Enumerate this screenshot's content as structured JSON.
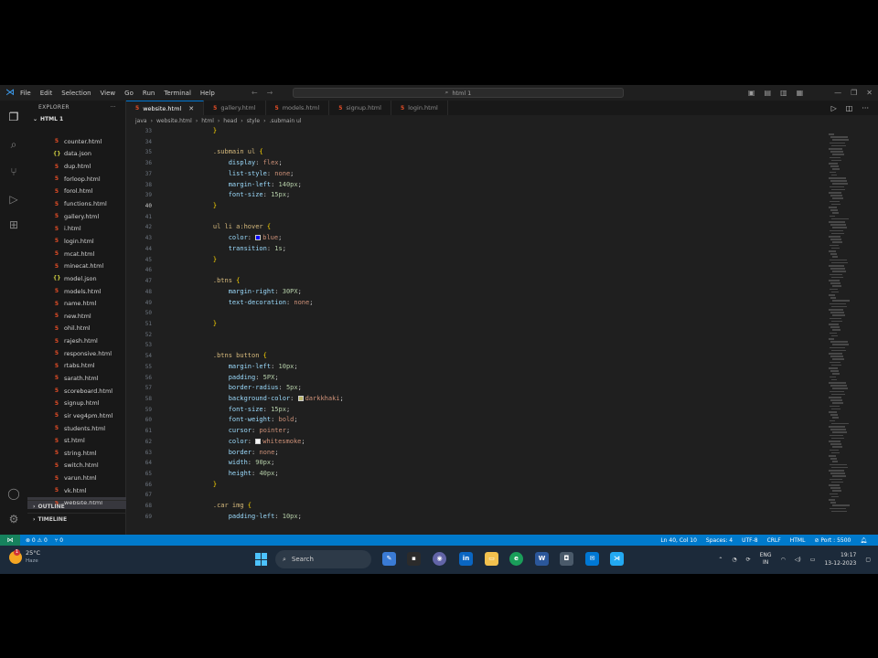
{
  "titlebar": {
    "menu": [
      "File",
      "Edit",
      "Selection",
      "View",
      "Go",
      "Run",
      "Terminal",
      "Help"
    ],
    "search_text": "html 1"
  },
  "sidebar": {
    "title": "EXPLORER",
    "more": "···",
    "folder": "HTML 1",
    "files": [
      {
        "name": "counter.html",
        "type": "html"
      },
      {
        "name": "data.json",
        "type": "json"
      },
      {
        "name": "dup.html",
        "type": "html"
      },
      {
        "name": "forloop.html",
        "type": "html"
      },
      {
        "name": "forol.html",
        "type": "html"
      },
      {
        "name": "functions.html",
        "type": "html"
      },
      {
        "name": "gallery.html",
        "type": "html"
      },
      {
        "name": "i.html",
        "type": "html"
      },
      {
        "name": "login.html",
        "type": "html"
      },
      {
        "name": "mcat.html",
        "type": "html"
      },
      {
        "name": "minecat.html",
        "type": "html"
      },
      {
        "name": "model.json",
        "type": "json"
      },
      {
        "name": "models.html",
        "type": "html"
      },
      {
        "name": "name.html",
        "type": "html"
      },
      {
        "name": "new.html",
        "type": "html"
      },
      {
        "name": "ohil.html",
        "type": "html"
      },
      {
        "name": "rajesh.html",
        "type": "html"
      },
      {
        "name": "responsive.html",
        "type": "html"
      },
      {
        "name": "rtabs.html",
        "type": "html"
      },
      {
        "name": "sarath.html",
        "type": "html"
      },
      {
        "name": "scoreboard.html",
        "type": "html"
      },
      {
        "name": "signup.html",
        "type": "html"
      },
      {
        "name": "sir veg4pm.html",
        "type": "html"
      },
      {
        "name": "students.html",
        "type": "html"
      },
      {
        "name": "st.html",
        "type": "html"
      },
      {
        "name": "string.html",
        "type": "html"
      },
      {
        "name": "switch.html",
        "type": "html"
      },
      {
        "name": "varun.html",
        "type": "html"
      },
      {
        "name": "vk.html",
        "type": "html"
      },
      {
        "name": "website.html",
        "type": "html",
        "active": true
      }
    ],
    "outline": "OUTLINE",
    "timeline": "TIMELINE"
  },
  "tabs": [
    {
      "label": "website.html",
      "active": true
    },
    {
      "label": "gallery.html",
      "active": false
    },
    {
      "label": "models.html",
      "active": false
    },
    {
      "label": "signup.html",
      "active": false
    },
    {
      "label": "login.html",
      "active": false
    }
  ],
  "breadcrumb": [
    "java",
    "website.html",
    "html",
    "head",
    "style",
    ".submain ul"
  ],
  "editor": {
    "current_line": "40",
    "lines": [
      {
        "n": "33",
        "t": [
          [
            "brace",
            "    }"
          ]
        ]
      },
      {
        "n": "34",
        "t": []
      },
      {
        "n": "35",
        "t": [
          [
            "sel",
            "    .submain ul "
          ],
          [
            "brace",
            "{"
          ]
        ]
      },
      {
        "n": "36",
        "t": [
          [
            "prop",
            "        display"
          ],
          [
            "",
            ": "
          ],
          [
            "val",
            "flex"
          ],
          [
            "",
            ";"
          ]
        ]
      },
      {
        "n": "37",
        "t": [
          [
            "prop",
            "        list-style"
          ],
          [
            "",
            ": "
          ],
          [
            "val",
            "none"
          ],
          [
            "",
            ";"
          ]
        ]
      },
      {
        "n": "38",
        "t": [
          [
            "prop",
            "        margin-left"
          ],
          [
            "",
            ": "
          ],
          [
            "num",
            "140px"
          ],
          [
            "",
            ";"
          ]
        ]
      },
      {
        "n": "39",
        "t": [
          [
            "prop",
            "        font-size"
          ],
          [
            "",
            ": "
          ],
          [
            "num",
            "15px"
          ],
          [
            "",
            ";"
          ]
        ]
      },
      {
        "n": "40",
        "t": [
          [
            "brace",
            "    }"
          ]
        ]
      },
      {
        "n": "41",
        "t": []
      },
      {
        "n": "42",
        "t": [
          [
            "sel",
            "    ul li a:hover "
          ],
          [
            "brace",
            "{"
          ]
        ]
      },
      {
        "n": "43",
        "t": [
          [
            "prop",
            "        color"
          ],
          [
            "",
            ": "
          ],
          [
            "swatch",
            "#0000ff"
          ],
          [
            "val",
            "blue"
          ],
          [
            "",
            ";"
          ]
        ]
      },
      {
        "n": "44",
        "t": [
          [
            "prop",
            "        transition"
          ],
          [
            "",
            ": "
          ],
          [
            "num",
            "1s"
          ],
          [
            "",
            ";"
          ]
        ]
      },
      {
        "n": "45",
        "t": [
          [
            "brace",
            "    }"
          ]
        ]
      },
      {
        "n": "46",
        "t": []
      },
      {
        "n": "47",
        "t": [
          [
            "sel",
            "    .btns "
          ],
          [
            "brace",
            "{"
          ]
        ]
      },
      {
        "n": "48",
        "t": [
          [
            "prop",
            "        margin-right"
          ],
          [
            "",
            ": "
          ],
          [
            "num",
            "30PX"
          ],
          [
            "",
            ";"
          ]
        ]
      },
      {
        "n": "49",
        "t": [
          [
            "prop",
            "        text-decoration"
          ],
          [
            "",
            ": "
          ],
          [
            "val",
            "none"
          ],
          [
            "",
            ";"
          ]
        ]
      },
      {
        "n": "50",
        "t": []
      },
      {
        "n": "51",
        "t": [
          [
            "brace",
            "    }"
          ]
        ]
      },
      {
        "n": "52",
        "t": []
      },
      {
        "n": "53",
        "t": []
      },
      {
        "n": "54",
        "t": [
          [
            "sel",
            "    .btns button "
          ],
          [
            "brace",
            "{"
          ]
        ]
      },
      {
        "n": "55",
        "t": [
          [
            "prop",
            "        margin-left"
          ],
          [
            "",
            ": "
          ],
          [
            "num",
            "10px"
          ],
          [
            "",
            ";"
          ]
        ]
      },
      {
        "n": "56",
        "t": [
          [
            "prop",
            "        padding"
          ],
          [
            "",
            ": "
          ],
          [
            "num",
            "5PX"
          ],
          [
            "",
            ";"
          ]
        ]
      },
      {
        "n": "57",
        "t": [
          [
            "prop",
            "        border-radius"
          ],
          [
            "",
            ": "
          ],
          [
            "num",
            "5px"
          ],
          [
            "",
            ";"
          ]
        ]
      },
      {
        "n": "58",
        "t": [
          [
            "prop",
            "        background-color"
          ],
          [
            "",
            ": "
          ],
          [
            "swatch",
            "#bdb76b"
          ],
          [
            "val",
            "darkkhaki"
          ],
          [
            "",
            ";"
          ]
        ]
      },
      {
        "n": "59",
        "t": [
          [
            "prop",
            "        font-size"
          ],
          [
            "",
            ": "
          ],
          [
            "num",
            "15px"
          ],
          [
            "",
            ";"
          ]
        ]
      },
      {
        "n": "60",
        "t": [
          [
            "prop",
            "        font-weight"
          ],
          [
            "",
            ": "
          ],
          [
            "val",
            "bold"
          ],
          [
            "",
            ";"
          ]
        ]
      },
      {
        "n": "61",
        "t": [
          [
            "prop",
            "        cursor"
          ],
          [
            "",
            ": "
          ],
          [
            "val",
            "pointer"
          ],
          [
            "",
            ";"
          ]
        ]
      },
      {
        "n": "62",
        "t": [
          [
            "prop",
            "        color"
          ],
          [
            "",
            ": "
          ],
          [
            "swatch",
            "#f5f5f5"
          ],
          [
            "val",
            "whitesmoke"
          ],
          [
            "",
            ";"
          ]
        ]
      },
      {
        "n": "63",
        "t": [
          [
            "prop",
            "        border"
          ],
          [
            "",
            ": "
          ],
          [
            "val",
            "none"
          ],
          [
            "",
            ";"
          ]
        ]
      },
      {
        "n": "64",
        "t": [
          [
            "prop",
            "        width"
          ],
          [
            "",
            ": "
          ],
          [
            "num",
            "90px"
          ],
          [
            "",
            ";"
          ]
        ]
      },
      {
        "n": "65",
        "t": [
          [
            "prop",
            "        height"
          ],
          [
            "",
            ": "
          ],
          [
            "num",
            "40px"
          ],
          [
            "",
            ";"
          ]
        ]
      },
      {
        "n": "66",
        "t": [
          [
            "brace",
            "    }"
          ]
        ]
      },
      {
        "n": "67",
        "t": []
      },
      {
        "n": "68",
        "t": [
          [
            "sel",
            "    .car img "
          ],
          [
            "brace",
            "{"
          ]
        ]
      },
      {
        "n": "69",
        "t": [
          [
            "prop",
            "        padding-left"
          ],
          [
            "",
            ": "
          ],
          [
            "num",
            "10px"
          ],
          [
            "",
            ";"
          ]
        ]
      }
    ]
  },
  "statusbar": {
    "problems": "⊗ 0 ⚠ 0",
    "ports": "⑂ 0",
    "position": "Ln 40, Col 10",
    "spaces": "Spaces: 4",
    "encoding": "UTF-8",
    "eol": "CRLF",
    "language": "HTML",
    "port": "⊘ Port : 5500"
  },
  "taskbar": {
    "temperature": "25°C",
    "weather": "Haze",
    "notification_count": "1",
    "search_label": "Search",
    "lang_top": "ENG",
    "lang_bottom": "IN",
    "time": "19:17",
    "date": "13-12-2023"
  },
  "colors": {
    "accent": "#007acc",
    "editor_bg": "#1f1f1f",
    "taskbar_bg": "#1c2a3a"
  }
}
